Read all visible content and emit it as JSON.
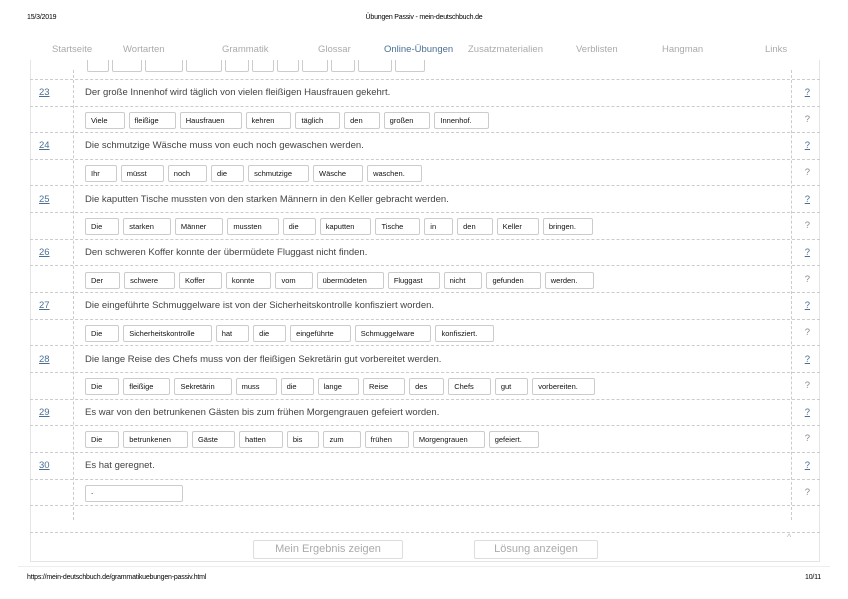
{
  "print_header": {
    "date": "15/3/2019",
    "title": "Übungen Passiv - mein-deutschbuch.de"
  },
  "print_footer": {
    "url": "https://mein-deutschbuch.de/grammatikuebungen-passiv.html",
    "page": "10/11"
  },
  "nav": [
    {
      "label": "Startseite",
      "active": false
    },
    {
      "label": "Wortarten",
      "active": false
    },
    {
      "label": "Grammatik",
      "active": false
    },
    {
      "label": "Glossar",
      "active": false
    },
    {
      "label": "Online-Übungen",
      "active": true
    },
    {
      "label": "Zusatzmaterialien",
      "active": false
    },
    {
      "label": "Verblisten",
      "active": false
    },
    {
      "label": "Hangman",
      "active": false
    },
    {
      "label": "Links",
      "active": false
    }
  ],
  "help_label": "?",
  "exercises": [
    {
      "num": "23",
      "sentence": "Der große Innenhof wird täglich von vielen fleißigen Hausfrauen gekehrt.",
      "words": [
        "Viele",
        "fleißige",
        "Hausfrauen",
        "kehren",
        "täglich",
        "den",
        "großen",
        "Innenhof."
      ]
    },
    {
      "num": "24",
      "sentence": "Die schmutzige Wäsche muss von euch noch gewaschen werden.",
      "words": [
        "Ihr",
        "müsst",
        "noch",
        "die",
        "schmutzige",
        "Wäsche",
        "waschen."
      ]
    },
    {
      "num": "25",
      "sentence": "Die kaputten Tische mussten von den starken Männern in den Keller gebracht werden.",
      "words": [
        "Die",
        "starken",
        "Männer",
        "mussten",
        "die",
        "kaputten",
        "Tische",
        "in",
        "den",
        "Keller",
        "bringen."
      ]
    },
    {
      "num": "26",
      "sentence": "Den schweren Koffer konnte der übermüdete Fluggast nicht finden.",
      "words": [
        "Der",
        "schwere",
        "Koffer",
        "konnte",
        "vom",
        "übermüdeten",
        "Fluggast",
        "nicht",
        "gefunden",
        "werden."
      ]
    },
    {
      "num": "27",
      "sentence": "Die eingeführte Schmuggelware ist von der Sicherheitskontrolle konfisziert worden.",
      "words": [
        "Die",
        "Sicherheitskontrolle",
        "hat",
        "die",
        "eingeführte",
        "Schmuggelware",
        "konfisziert."
      ]
    },
    {
      "num": "28",
      "sentence": "Die lange Reise des Chefs muss von der fleißigen Sekretärin gut vorbereitet werden.",
      "words": [
        "Die",
        "fleißige",
        "Sekretärin",
        "muss",
        "die",
        "lange",
        "Reise",
        "des",
        "Chefs",
        "gut",
        "vorbereiten."
      ]
    },
    {
      "num": "29",
      "sentence": "Es war von den betrunkenen Gästen bis zum frühen Morgengrauen gefeiert worden.",
      "words": [
        "Die",
        "betrunkenen",
        "Gäste",
        "hatten",
        "bis",
        "zum",
        "frühen",
        "Morgengrauen",
        "gefeiert."
      ]
    },
    {
      "num": "30",
      "sentence": "Es hat geregnet.",
      "input_value": "."
    }
  ],
  "buttons": {
    "result": "Mein Ergebnis zeigen",
    "solution": "Lösung anzeigen"
  },
  "scroll_top": "^"
}
